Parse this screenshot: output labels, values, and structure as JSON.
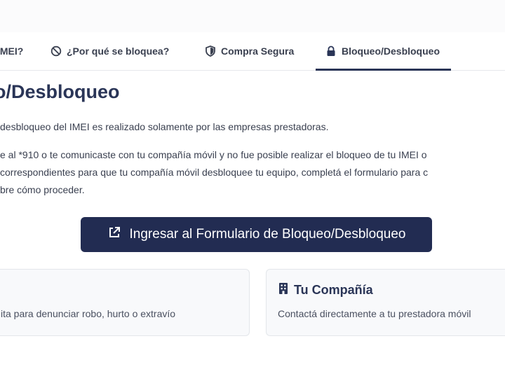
{
  "tabs": [
    {
      "label": "IMEI?",
      "icon": "none"
    },
    {
      "label": "¿Por qué se bloquea?",
      "icon": "ban-icon"
    },
    {
      "label": "Compra Segura",
      "icon": "shield-icon"
    },
    {
      "label": "Bloqueo/Desbloqueo",
      "icon": "lock-icon",
      "active": true
    }
  ],
  "main": {
    "title": "o/Desbloqueo",
    "paragraph1": "desbloqueo del IMEI es realizado solamente por las empresas prestadoras.",
    "paragraph2_line1": "e al *910 o te comunicaste con tu compañía móvil y no fue posible realizar el bloqueo de tu IMEI o",
    "paragraph2_line2": "correspondientes para que tu compañía móvil desbloquee tu equipo, completá el formulario para c",
    "paragraph2_line3": "bre cómo proceder.",
    "form_button_label": "Ingresar al Formulario de Bloqueo/Desbloqueo"
  },
  "cards": [
    {
      "title": "",
      "description": "ita para denunciar robo, hurto o extravío"
    },
    {
      "title": "Tu Compañía",
      "description": "Contactá directamente a tu prestadora móvil"
    }
  ],
  "colors": {
    "accent": "#222c52",
    "heading": "#2a3557"
  }
}
